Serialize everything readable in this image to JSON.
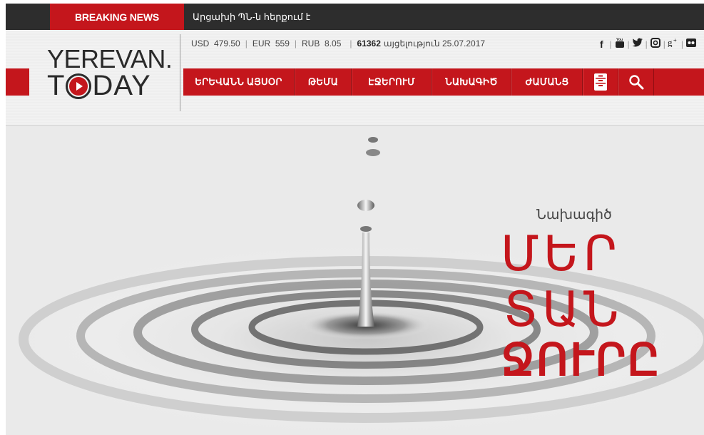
{
  "breaking": {
    "label": "BREAKING NEWS",
    "text": "Արցախի ՊՆ-ն հերքում է"
  },
  "logo": {
    "top": "YEREVAN.",
    "bottom_pre": "T",
    "bottom_post": "DAY"
  },
  "rates": [
    {
      "code": "USD",
      "value": "479.50"
    },
    {
      "code": "EUR",
      "value": "559"
    },
    {
      "code": "RUB",
      "value": "8.05"
    }
  ],
  "visits": {
    "count": "61362",
    "label": "այցելություն 25.07.2017"
  },
  "social": [
    "facebook-icon",
    "youtube-icon",
    "twitter-icon",
    "instagram-icon",
    "googleplus-icon",
    "flickr-icon"
  ],
  "social_glyphs": [
    "f",
    "▣",
    "🐦",
    "◎",
    "g+",
    "●●"
  ],
  "nav": {
    "items": [
      {
        "label": "ԵՐԵՎԱՆՆ ԱՅՍՕՐ",
        "width": 156
      },
      {
        "label": "ԹԵՄԱ",
        "width": 80
      },
      {
        "label": "ԷՋԵՐՈՒՄ",
        "width": 112
      },
      {
        "label": "ՆԱԽԱԳԻԾ",
        "width": 112
      },
      {
        "label": "ԺԱՄԱՆՑ",
        "width": 100
      }
    ],
    "archive_icon": "archive-icon",
    "search_icon": "search-icon"
  },
  "hero": {
    "subtitle": "Նախագիծ",
    "line1": "ՄԵՐ",
    "line2": "ՏԱՆ",
    "line3": "ՋՈՒՐԸ"
  },
  "colors": {
    "brand_red": "#c4161c",
    "dark_bar": "#2d2d2d"
  }
}
